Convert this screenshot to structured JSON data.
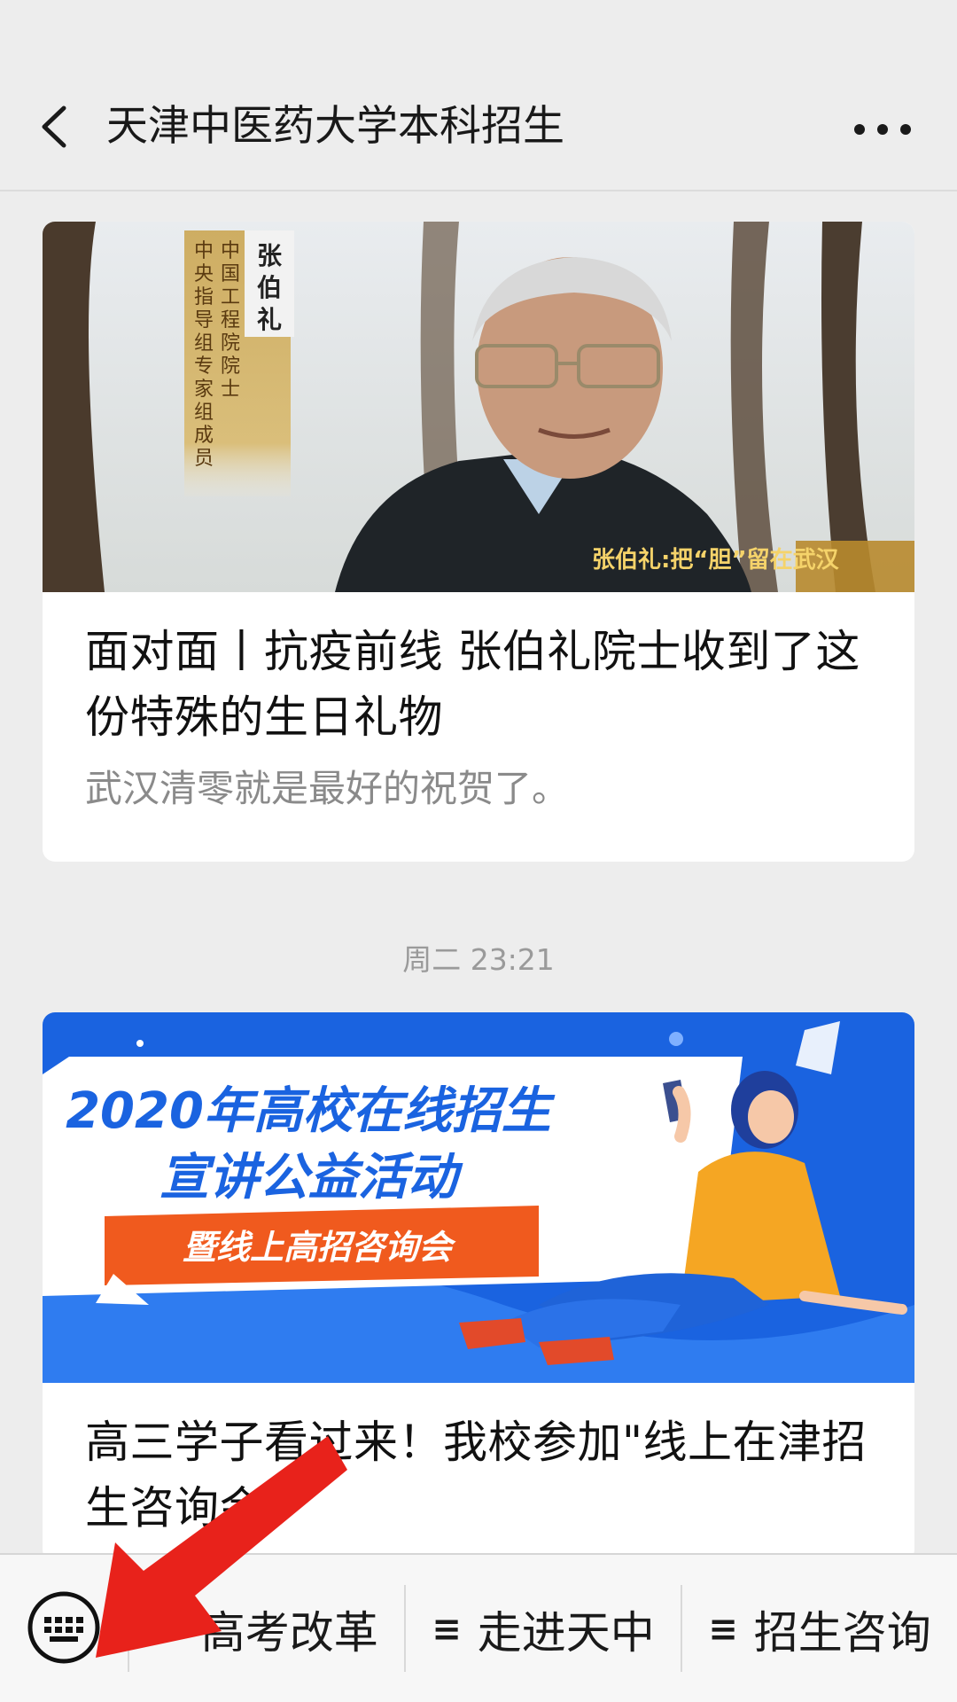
{
  "header": {
    "title": "天津中医药大学本科招生",
    "back_icon": "chevron-left-icon",
    "more_icon": "more-dots-icon"
  },
  "articles": [
    {
      "image": {
        "overlay_name": "张伯礼",
        "overlay_title": "中国工程院院士 中央指导组专家组成员",
        "caption": "张伯礼:把“胆”留在武汉"
      },
      "title": "面对面丨抗疫前线 张伯礼院士收到了这份特殊的生日礼物",
      "digest": "武汉清零就是最好的祝贺了。"
    },
    {
      "image": {
        "headline_line1": "2020年高校在线招生",
        "headline_line2": "宣讲公益活动",
        "ribbon": "暨线上高招咨询会"
      },
      "title": "高三学子看过来！我校参加\"线上在津招生咨询会\"",
      "digest": ""
    }
  ],
  "timestamp": "周二 23:21",
  "bottom_menu": {
    "keyboard_icon": "keyboard-icon",
    "items": [
      {
        "label": "高考改革",
        "icon": "≡"
      },
      {
        "label": "走进天中",
        "icon": "≡"
      },
      {
        "label": "招生咨询",
        "icon": "≡"
      }
    ]
  },
  "colors": {
    "background": "#ededed",
    "card": "#ffffff",
    "digest": "#8a8a8a",
    "banner_blue": "#1a63e0",
    "ribbon_orange": "#f05a1e",
    "arrow_red": "#e8221b"
  }
}
